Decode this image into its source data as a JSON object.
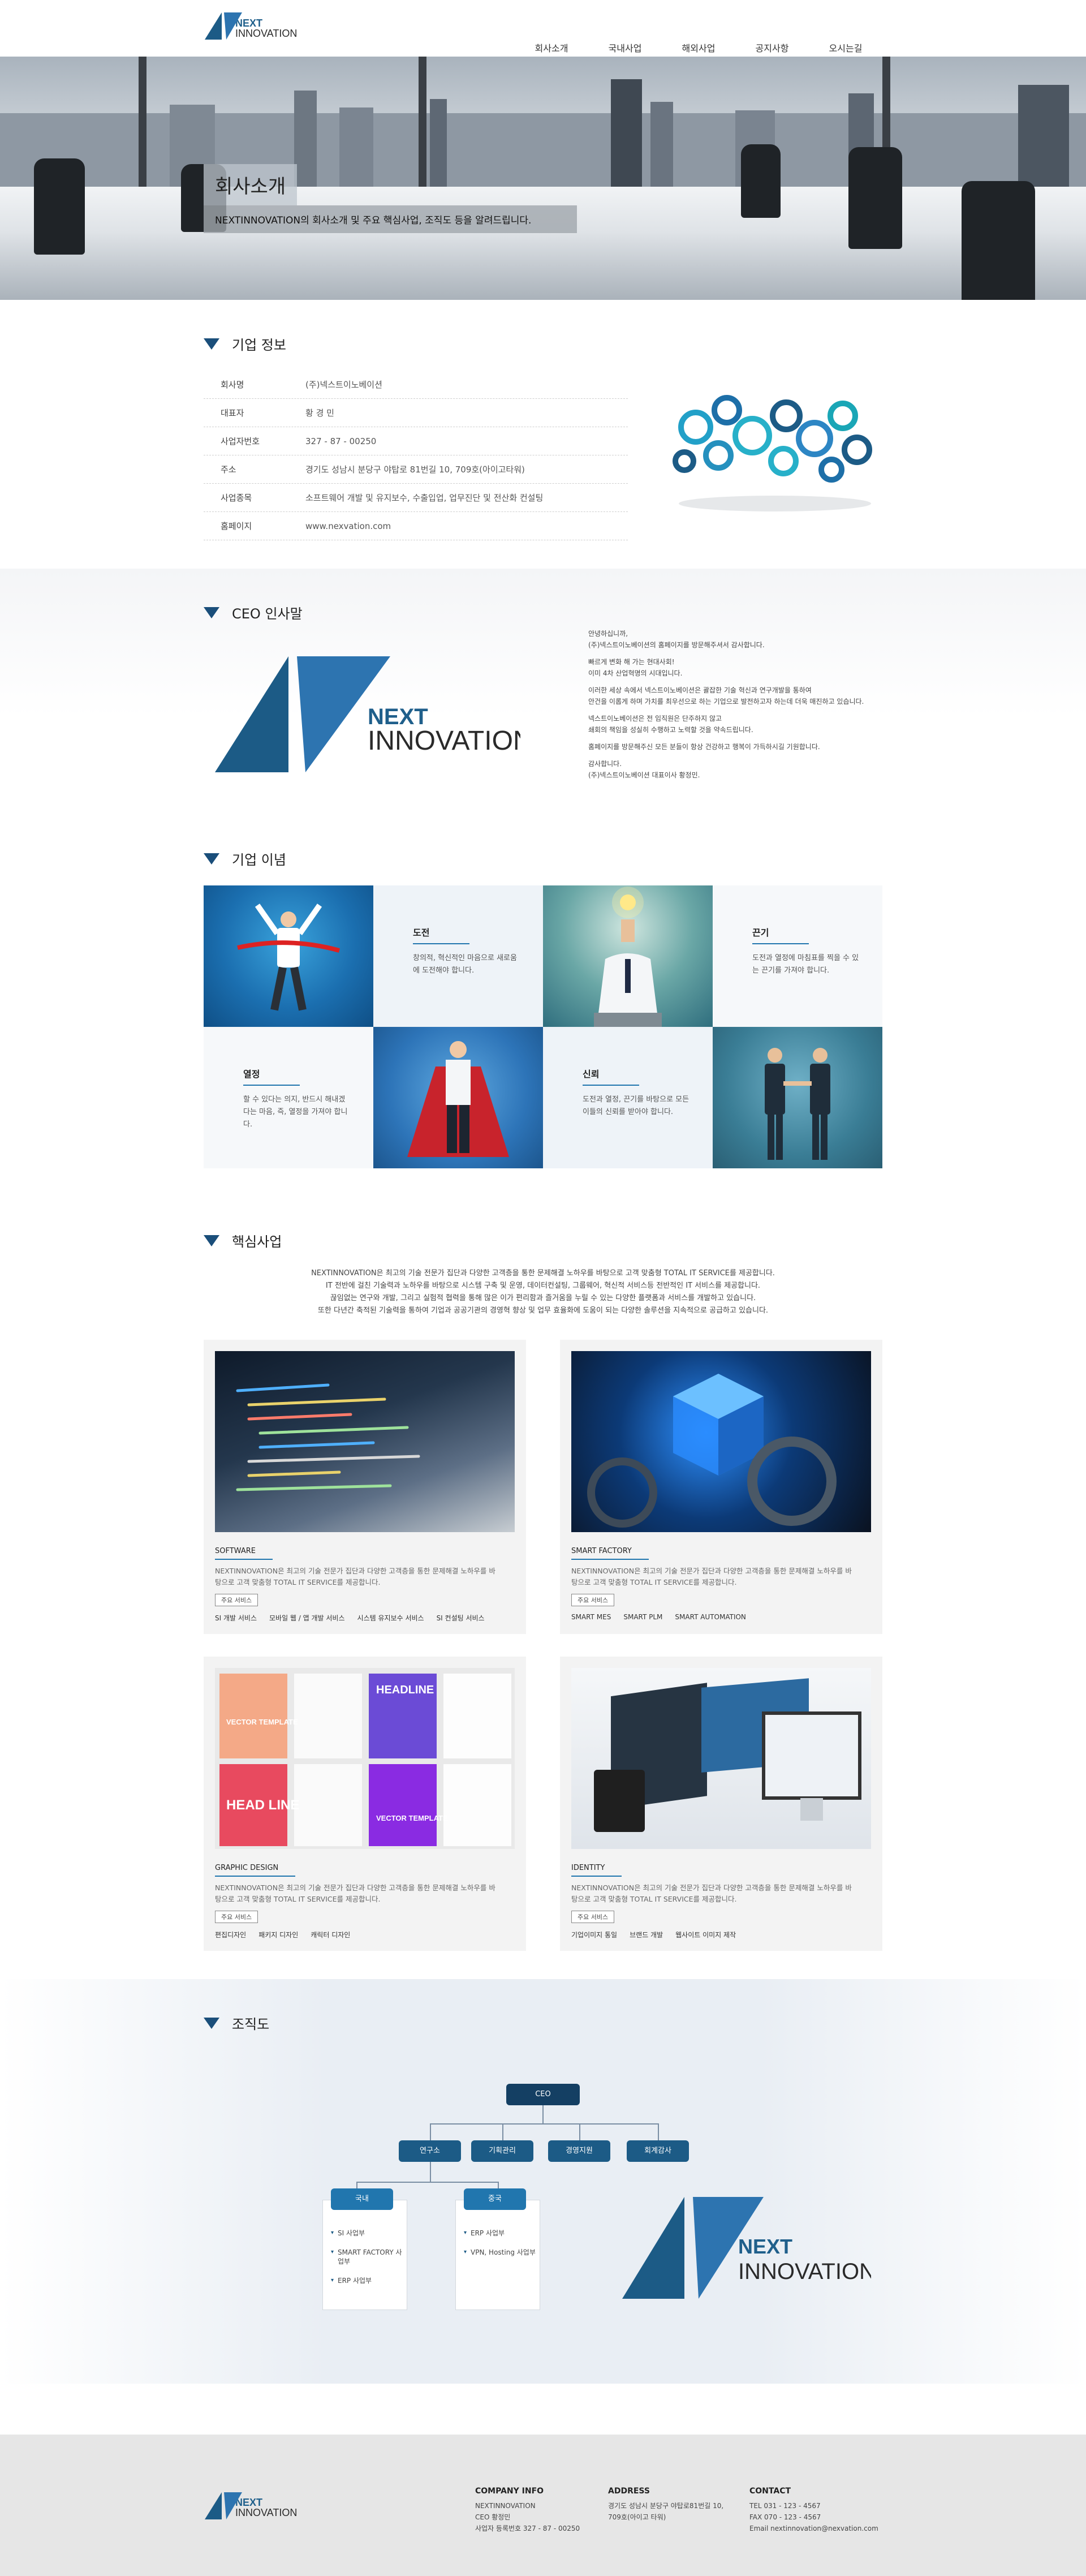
{
  "header": {
    "logo": {
      "line1": "NEXT",
      "line2": "INNOVATION"
    },
    "nav": [
      "회사소개",
      "국내사업",
      "해외사업",
      "공지사항",
      "오시는길"
    ]
  },
  "hero": {
    "title": "회사소개",
    "subtitle": "NEXTINNOVATION의 회사소개 및 주요 핵심사업, 조직도 등을 알려드립니다."
  },
  "company": {
    "title": "기업 정보",
    "rows": [
      {
        "k": "회사명",
        "v": "(주)넥스트이노베이션"
      },
      {
        "k": "대표자",
        "v": "황 경 민"
      },
      {
        "k": "사업자번호",
        "v": "327 - 87 - 00250"
      },
      {
        "k": "주소",
        "v": "경기도 성남시 분당구 야탑로 81번길 10, 709호(아이고타워)"
      },
      {
        "k": "사업종목",
        "v": "소프트웨어 개발 및 유지보수, 수출입업, 업무진단 및 전산화 컨설팅"
      },
      {
        "k": "홈페이지",
        "v": "www.nexvation.com"
      }
    ]
  },
  "ceo": {
    "title": "CEO 인사말",
    "logo": {
      "line1": "NEXT",
      "line2": "INNOVATION"
    },
    "paragraphs": [
      "안녕하십니까,\n(주)넥스트이노베이션의 홈페이지를 방문해주셔서 감사합니다.",
      "빠르게 변화 해 가는 현대사회!\n이미 4차 산업혁명의 시대입니다.",
      "이러한 세상 속에서 넥스트이노베이션은 괄잡한 기술 혁신과 연구개발을 통하여\n안건을 이롭게 하며 가치를 최우선으로 하는 기업으로 발전하고자 하는데 더욱 매진하고 있습니다.",
      "넥스트이노베이션은 전 임직원은 단주하지 않고\n쇄회의 책임을 성실히 수행하고 노력할 것을 약속드립니다.",
      "홈페이지를 방문해주신 모든 분들이 항상 건강하고 행복이 가득하시길 기원합니다.",
      "감사합니다.\n(주)넥스트이노베이션 대표이사 황정민."
    ]
  },
  "philosophy": {
    "title": "기업 이념",
    "items": [
      {
        "title": "도전",
        "desc": "창의적, 혁신적인 마음으로 새로움에 도전해야 합니다."
      },
      {
        "title": "끈기",
        "desc": "도전과 열정에 마침표를 찍을 수 있는 끈기를 가져야 합니다."
      },
      {
        "title": "열정",
        "desc": "할 수 있다는 의지, 반드시 해내겠다는 마음, 즉, 열정을 가져야 합니다."
      },
      {
        "title": "신뢰",
        "desc": "도전과 열정, 끈기를 바탕으로 모든 이들의 신뢰를 받아야 합니다."
      }
    ]
  },
  "core": {
    "title": "핵심사업",
    "intro": [
      "NEXTINNOVATION은 최고의 기술 전문가 집단과 다양한 고객층을 통한 문제해결 노하우를 바탕으로 고객 맞춤형 TOTAL IT SERVICE를 제공합니다.",
      "IT 전반에 걸친 기술력과 노하우를 바탕으로 시스템 구축 및 운영, 데이터컨설팅, 그룹웨어, 혁신적 서비스등 전반적인 IT 서비스를 제공합니다.",
      "끊임없는 연구와 개발, 그리고 실험적 협력을 통해 많은 이가 편리함과 즐거움을 누릴 수 있는 다양한 플랫폼과 서비스를 개발하고 있습니다.",
      "또한 다년간 축적된 기술력을 통하여 기업과 공공기관의 경영혁 향상 및 업무 효율화에 도움이 되는 다양한 솔루션을 지속적으로 공급하고 있습니다."
    ],
    "items": [
      {
        "title": "SOFTWARE",
        "desc": "NEXTINNOVATION은 최고의 기술 전문가 집단과 다양한 고객층을 통한 문제해결 노하우를 바탕으로 고객 맞춤형 TOTAL IT SERVICE를 제공합니다.",
        "tag": "주요 서비스",
        "services": [
          "SI 개발 서비스",
          "모바일 웹 / 앱 개발 서비스",
          "시스템 유지보수 서비스",
          "SI 컨설팅 서비스"
        ]
      },
      {
        "title": "SMART FACTORY",
        "desc": "NEXTINNOVATION은 최고의 기술 전문가 집단과 다양한 고객층을 통한 문제해결 노하우를 바탕으로 고객 맞춤형 TOTAL IT SERVICE를 제공합니다.",
        "tag": "주요 서비스",
        "services": [
          "SMART MES",
          "SMART PLM",
          "SMART AUTOMATION"
        ]
      },
      {
        "title": "GRAPHIC DESIGN",
        "desc": "NEXTINNOVATION은 최고의 기술 전문가 집단과 다양한 고객층을 통한 문제해결 노하우를 바탕으로 고객 맞춤형 TOTAL IT SERVICE를 제공합니다.",
        "tag": "주요 서비스",
        "services": [
          "편집디자인",
          "패키지 디자인",
          "캐릭터 디자인"
        ]
      },
      {
        "title": "IDENTITY",
        "desc": "NEXTINNOVATION은 최고의 기술 전문가 집단과 다양한 고객층을 통한 문제해결 노하우를 바탕으로 고객 맞춤형 TOTAL IT SERVICE를 제공합니다.",
        "tag": "주요 서비스",
        "services": [
          "기업이미지 통일",
          "브랜드 개발",
          "웹사이트 이미지 제작"
        ]
      }
    ],
    "design_labels": {
      "vector": "VECTOR TEMPLATE",
      "headline": "HEADLINE",
      "head_line": "HEAD LINE"
    }
  },
  "org": {
    "title": "조직도",
    "ceo": "CEO",
    "depts": [
      "연구소",
      "기획관리",
      "경영지원",
      "회계감사"
    ],
    "divisions": [
      {
        "name": "국내",
        "items": [
          "SI 사업부",
          "SMART FACTORY 사업부",
          "ERP 사업부"
        ]
      },
      {
        "name": "중국",
        "items": [
          "ERP 사업부",
          "VPN, Hosting 사업부"
        ]
      }
    ],
    "logo": {
      "line1": "NEXT",
      "line2": "INNOVATION"
    }
  },
  "footer": {
    "logo": {
      "line1": "NEXT",
      "line2": "INNOVATION"
    },
    "company": {
      "title": "COMPANY INFO",
      "lines": [
        "NEXTINNOVATION",
        "CEO 황정민",
        "사업자 등록번호 327 - 87 - 00250"
      ]
    },
    "address": {
      "title": "ADDRESS",
      "lines": [
        "경기도 성남시 분당구 야탑로81번길 10,",
        "709호(아이고 타워)"
      ]
    },
    "contact": {
      "title": "CONTACT",
      "lines": [
        "TEL 031 - 123 - 4567",
        "FAX 070 - 123 - 4567",
        "Email nextinnovation@nexvation.com"
      ]
    }
  },
  "colors": {
    "brand": "#1c5b86",
    "accent": "#2176ae"
  }
}
